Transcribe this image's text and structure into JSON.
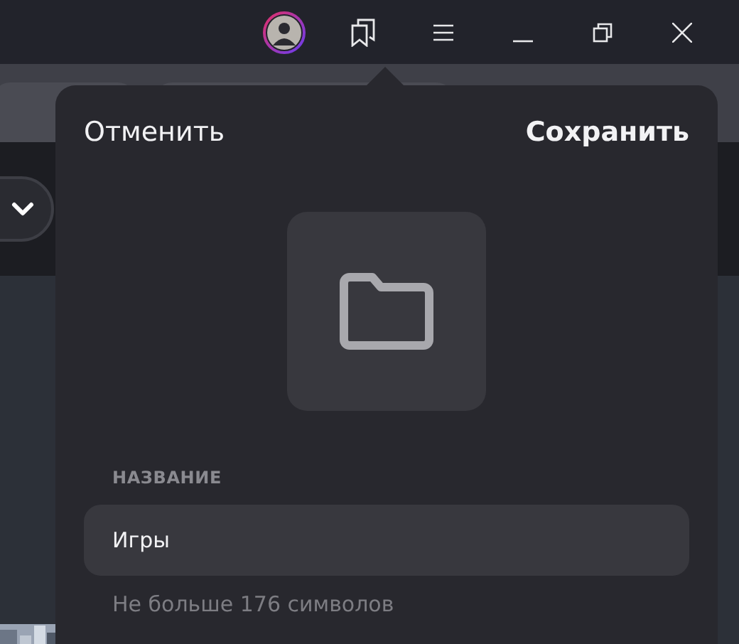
{
  "popup": {
    "cancel_button": "Отменить",
    "save_button": "Сохранить",
    "field_label": "НАЗВАНИЕ",
    "name_field": {
      "value": "Игры"
    },
    "hint": "Не больше 176 символов"
  }
}
